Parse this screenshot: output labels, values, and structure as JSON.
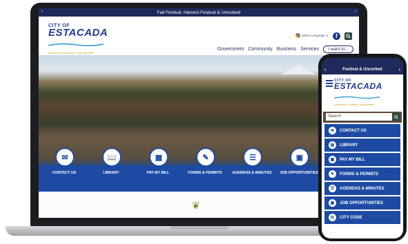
{
  "alert": {
    "text": "Fall Festival: Harvest Festival & Uncorked",
    "phone_text": "Festival & Uncorked"
  },
  "logo": {
    "city": "CITY OF",
    "name": "ESTACADA",
    "tagline": "unexpected | untamed | unforgettable"
  },
  "translate": {
    "label": "Select Language"
  },
  "nav": {
    "items": [
      "Government",
      "Community",
      "Business",
      "Services"
    ],
    "cta": "I want to..."
  },
  "quick_links": [
    {
      "label": "CONTACT US",
      "icon": "envelope-icon"
    },
    {
      "label": "LIBRARY",
      "icon": "book-icon"
    },
    {
      "label": "PAY MY BILL",
      "icon": "bill-icon"
    },
    {
      "label": "FORMS & PERMITS",
      "icon": "form-icon"
    },
    {
      "label": "AGENDAS & MINUTES",
      "icon": "clipboard-icon"
    },
    {
      "label": "JOB OPPORTUNITIES",
      "icon": "briefcase-icon"
    }
  ],
  "phone": {
    "search_placeholder": "Search",
    "links": [
      {
        "label": "CONTACT US",
        "icon": "envelope-icon"
      },
      {
        "label": "LIBRARY",
        "icon": "book-icon"
      },
      {
        "label": "PAY MY BILL",
        "icon": "bill-icon"
      },
      {
        "label": "FORMS & PERMITS",
        "icon": "form-icon"
      },
      {
        "label": "AGENDAS & MINUTES",
        "icon": "clipboard-icon"
      },
      {
        "label": "JOB OPPORTUNITIES",
        "icon": "briefcase-icon"
      },
      {
        "label": "CITY CODE",
        "icon": "gavel-icon"
      }
    ]
  },
  "colors": {
    "navy": "#1e2a5a",
    "brand_blue": "#1d4ba3",
    "logo_blue": "#1e3b8a",
    "gold": "#c8a21e"
  }
}
